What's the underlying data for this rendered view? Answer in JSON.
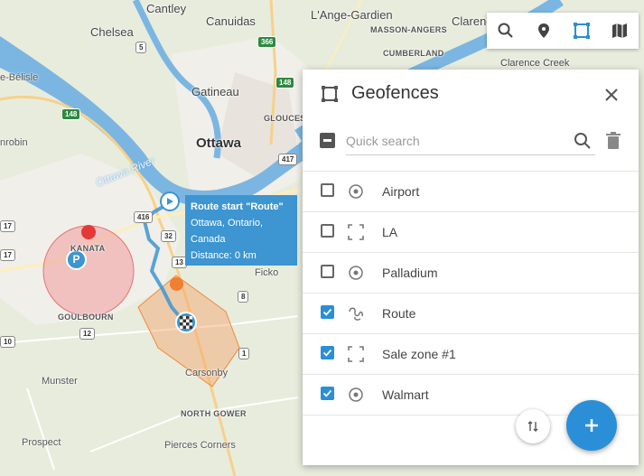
{
  "map": {
    "labels": {
      "cantley": "Cantley",
      "chelsea": "Chelsea",
      "gatineau": "Gatineau",
      "ottawa": "Ottawa",
      "ottawa_river": "Ottawa River",
      "lange_gardien": "L'Ange-Gardien",
      "clarence": "Clarence",
      "masson_angers": "MASSON-ANGERS",
      "cumberland": "CUMBERLAND",
      "clarence_creek": "Clarence Creek",
      "gloucester": "GLOUCEST",
      "kanata": "KANATA",
      "goulbourn": "GOULBOURN",
      "munster": "Munster",
      "prospect": "Prospect",
      "pierces_corners": "Pierces Corners",
      "carsonby": "Carsonby",
      "north_gower": "NORTH GOWER",
      "ficko": "Ficko",
      "bel_isle": "e-Bélisle",
      "pontiac_corner": "nrobin",
      "canuidas": "Canuidas"
    },
    "shields": {
      "r5": "5",
      "r366": "366",
      "r148a": "148",
      "r148b": "148",
      "r417": "417",
      "r416": "416",
      "r32": "32",
      "r13": "13",
      "r12": "12",
      "r17a": "17",
      "r17b": "17",
      "r10": "10",
      "r8": "8",
      "r1": "1"
    },
    "route_tooltip": {
      "title": "Route start \"Route\"",
      "location": "Ottawa, Ontario, Canada",
      "distance": "Distance: 0 km"
    },
    "colors": {
      "route": "#3d95d1",
      "circle_fence": "#f08a8a",
      "polygon_fence": "#f5a56a"
    }
  },
  "toolbar": {
    "icons": [
      "search-icon",
      "location-pin-icon",
      "geofence-icon",
      "map-icon"
    ]
  },
  "panel": {
    "title": "Geofences",
    "search_placeholder": "Quick search",
    "items": [
      {
        "label": "Airport",
        "checked": false,
        "icon": "circle-fence-icon"
      },
      {
        "label": "LA",
        "checked": false,
        "icon": "polygon-fence-icon"
      },
      {
        "label": "Palladium",
        "checked": false,
        "icon": "circle-fence-icon"
      },
      {
        "label": "Route",
        "checked": true,
        "icon": "route-fence-icon"
      },
      {
        "label": "Sale zone #1",
        "checked": true,
        "icon": "polygon-fence-icon"
      },
      {
        "label": "Walmart",
        "checked": true,
        "icon": "circle-fence-icon"
      }
    ],
    "accent": "#2a8fd6"
  }
}
